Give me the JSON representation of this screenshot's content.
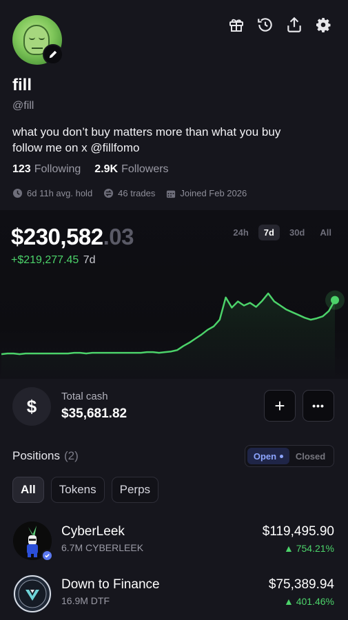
{
  "profile": {
    "name": "fill",
    "handle": "@fill",
    "bio_line1": "what you don’t buy matters more than what you buy",
    "bio_line2": "follow me on x @fillfomo",
    "following_count": "123",
    "following_label": "Following",
    "followers_count": "2.9K",
    "followers_label": "Followers",
    "avg_hold": "6d 11h avg. hold",
    "trades": "46 trades",
    "joined": "Joined Feb 2026"
  },
  "header_icons": [
    "gift-icon",
    "history-icon",
    "share-icon",
    "settings-icon"
  ],
  "portfolio": {
    "value_main": "$230,582",
    "value_cents": ".03",
    "change": "+$219,277.45",
    "change_period": "7d",
    "ranges": [
      "24h",
      "7d",
      "30d",
      "All"
    ],
    "active_range": "7d",
    "accent_color": "#4cd36a"
  },
  "chart_data": {
    "type": "line",
    "title": "",
    "xlabel": "",
    "ylabel": "",
    "grid": false,
    "y_relative": [
      4,
      5,
      5,
      4,
      5,
      5,
      5,
      5,
      5,
      5,
      5,
      5,
      6,
      6,
      5,
      6,
      6,
      6,
      6,
      6,
      6,
      6,
      6,
      6,
      7,
      7,
      6,
      7,
      8,
      10,
      16,
      21,
      27,
      33,
      40,
      45,
      55,
      88,
      73,
      82,
      76,
      80,
      74,
      83,
      94,
      82,
      76,
      70,
      66,
      62,
      58,
      55,
      57,
      60,
      68,
      84
    ],
    "ylim": [
      0,
      100
    ]
  },
  "cash": {
    "label": "Total cash",
    "amount": "$35,681.82",
    "add_symbol": "+",
    "more_symbol": "•••"
  },
  "positions": {
    "title": "Positions",
    "count": "(2)",
    "open_label": "Open",
    "closed_label": "Closed",
    "filters": [
      "All",
      "Tokens",
      "Perps"
    ],
    "items": [
      {
        "name": "CyberLeek",
        "holding": "6.7M CYBERLEEK",
        "value": "$119,495.90",
        "change": "▲ 754.21%"
      },
      {
        "name": "Down to Finance",
        "holding": "16.9M DTF",
        "value": "$75,389.94",
        "change": "▲ 401.46%"
      }
    ]
  }
}
